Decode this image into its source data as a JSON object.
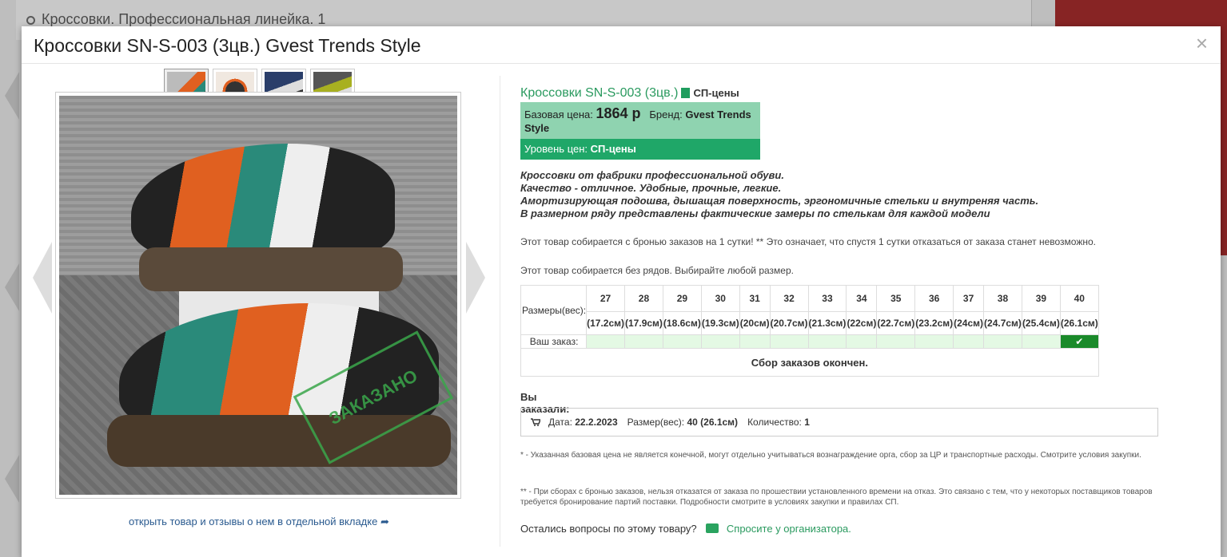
{
  "background": {
    "page_title": "Кроссовки. Профессиональная линейка. 1"
  },
  "modal": {
    "title": "Кроссовки SN-S-003 (3цв.) Gvest Trends Style",
    "close_symbol": "×"
  },
  "gallery": {
    "thumbnail_count": 4,
    "stamp_text": "ЗАКАЗАНО",
    "open_link": "открыть товар и отзывы о нем в отдельной вкладке"
  },
  "product": {
    "name": "Кроссовки SN-S-003 (3цв.)",
    "sp_label": "СП-цены",
    "base_price_label": "Базовая цена:",
    "base_price": "1864 р",
    "brand_label": "Бренд:",
    "brand": "Gvest Trends Style",
    "price_level_label": "Уровень цен:",
    "price_level": "СП-цены",
    "description": [
      "Кроссовки от фабрики профессиональной обуви.",
      "Качество - отличное. Удобные, прочные, легкие.",
      "Амортизирующая подошва, дышащая поверхность, эргономичные стельки и внутреняя часть.",
      "В размерном ряду представлены фактические замеры по стелькам для каждой модели"
    ],
    "reservation_note": "Этот товар собирается с бронью заказов на 1 сутки! ** Это означает, что спустя 1 сутки отказаться от заказа станет невозможно.",
    "rows_note": "Этот товар собирается без рядов. Выбирайте любой размер."
  },
  "sizes": {
    "row_label": "Размеры(вес):",
    "order_label": "Ваш заказ:",
    "sizes": [
      "27",
      "28",
      "29",
      "30",
      "31",
      "32",
      "33",
      "34",
      "35",
      "36",
      "37",
      "38",
      "39",
      "40"
    ],
    "measures": [
      "(17.2см)",
      "(17.9см)",
      "(18.6см)",
      "(19.3см)",
      "(20см)",
      "(20.7см)",
      "(21.3см)",
      "(22см)",
      "(22.7см)",
      "(23.2см)",
      "(24см)",
      "(24.7см)",
      "(25.4см)",
      "(26.1см)"
    ],
    "selected_size": "40",
    "closed_text": "Сбор заказов окончен."
  },
  "order": {
    "title": "Вы заказали:",
    "date_label": "Дата:",
    "date": "22.2.2023",
    "size_label": "Размер(вес):",
    "size": "40 (26.1см)",
    "qty_label": "Количество:",
    "qty": "1"
  },
  "footnotes": {
    "f1": "* - Указанная базовая цена не является конечной, могут отдельно учитываться вознаграждение орга, сбор за ЦР и транспортные расходы. Смотрите условия закупки.",
    "f2": "** - При сборах с бронью заказов, нельзя отказатся от заказа по прошествии установленного времени на отказ. Это связано с тем, что у некоторых поставщиков товаров требуется бронирование партий поставки. Подробности смотрите в условиях закупки и правилах СП."
  },
  "question": {
    "text": "Остались вопросы по этому товару?",
    "link": "Спросите у организатора."
  },
  "colors": {
    "accent_green": "#1fa768",
    "light_green": "#8fd3b0",
    "selected_cell": "#1a8a2a",
    "link_blue": "#2a5a8f"
  }
}
